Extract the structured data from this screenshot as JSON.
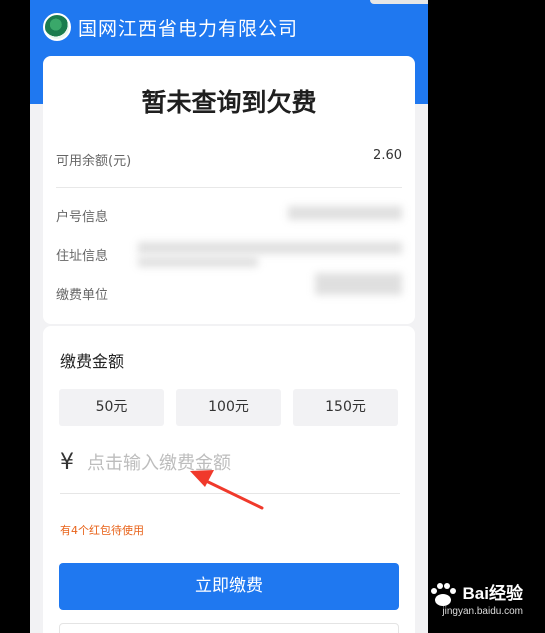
{
  "header": {
    "company": "国网江西省电力有限公司",
    "brand_color": "#1f78f0"
  },
  "summary": {
    "headline": "暂未查询到欠费",
    "balance_label": "可用余额(元)",
    "balance_value": "2.60",
    "account_label": "户号信息",
    "address_label": "住址信息",
    "unit_label": "缴费单位"
  },
  "payment": {
    "section_title": "缴费金额",
    "presets": [
      "50元",
      "100元",
      "150元"
    ],
    "currency_symbol": "¥",
    "amount_placeholder": "点击输入缴费金额",
    "coupon_note": "有4个红包待使用",
    "coupon_color": "#e8631a",
    "pay_button": "立即缴费"
  },
  "watermark": {
    "brand": "Bai经验",
    "sub": "jingyan.baidu.com"
  }
}
